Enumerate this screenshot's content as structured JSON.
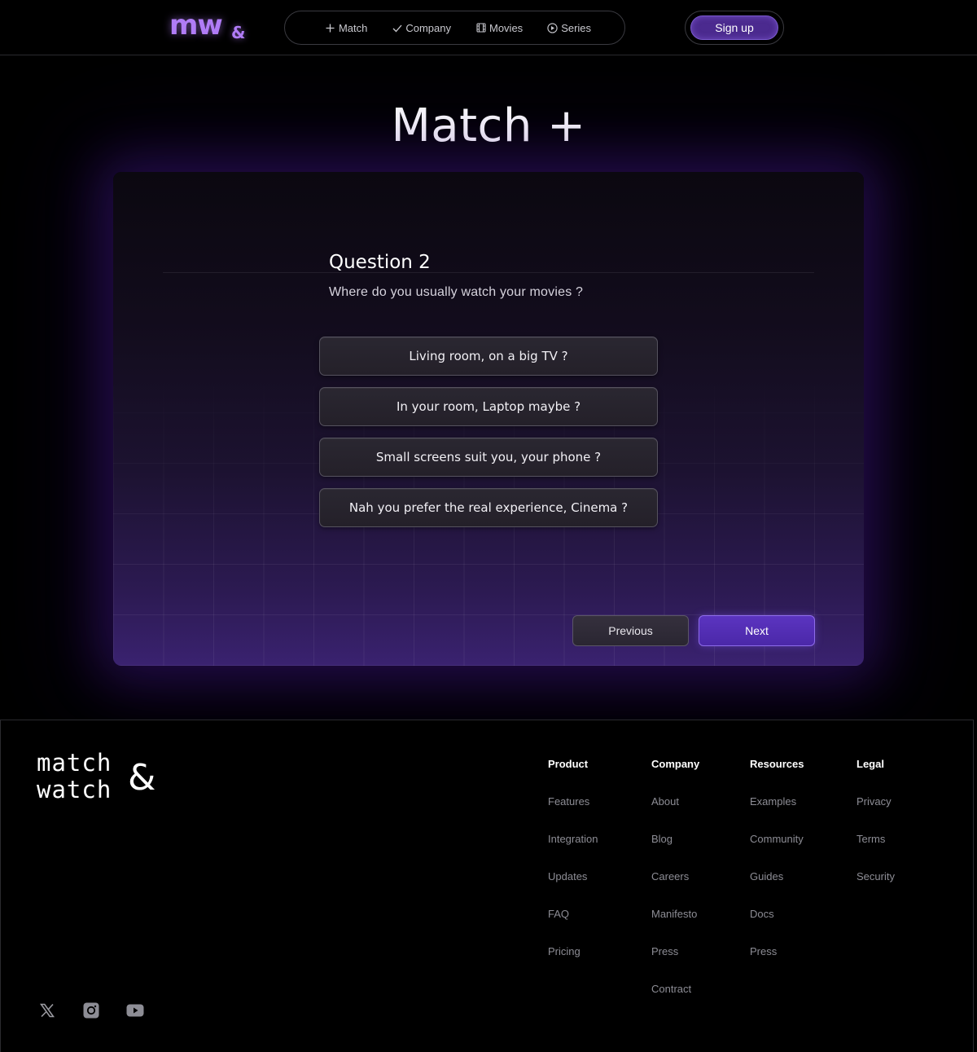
{
  "header": {
    "logo_text": "mw",
    "logo_amp": "&",
    "nav": [
      {
        "label": "Match",
        "icon": "plus-icon"
      },
      {
        "label": "Company",
        "icon": "check-icon"
      },
      {
        "label": "Movies",
        "icon": "film-icon"
      },
      {
        "label": "Series",
        "icon": "play-circle-icon"
      }
    ],
    "signup_label": "Sign up"
  },
  "page_title": "Match +",
  "quiz": {
    "question_title": "Question 2",
    "question_text": "Where do you usually watch your movies ?",
    "options": [
      "Living room, on a big TV ?",
      "In your room, Laptop maybe ?",
      "Small screens suit you, your phone ?",
      "Nah you prefer the real experience, Cinema ?"
    ],
    "previous_label": "Previous",
    "next_label": "Next"
  },
  "footer": {
    "logo_line1": "match",
    "logo_line2": "watch",
    "logo_amp": "&",
    "columns": [
      {
        "heading": "Product",
        "links": [
          "Features",
          "Integration",
          "Updates",
          "FAQ",
          "Pricing"
        ]
      },
      {
        "heading": "Company",
        "links": [
          "About",
          "Blog",
          "Careers",
          "Manifesto",
          "Press",
          "Contract"
        ]
      },
      {
        "heading": "Resources",
        "links": [
          "Examples",
          "Community",
          "Guides",
          "Docs",
          "Press"
        ]
      },
      {
        "heading": "Legal",
        "links": [
          "Privacy",
          "Terms",
          "Security"
        ]
      }
    ],
    "social": [
      "x-icon",
      "instagram-icon",
      "youtube-icon"
    ]
  },
  "colors": {
    "accent": "#5b34c0",
    "logo_purple": "#b07cf6",
    "background": "#000000"
  }
}
